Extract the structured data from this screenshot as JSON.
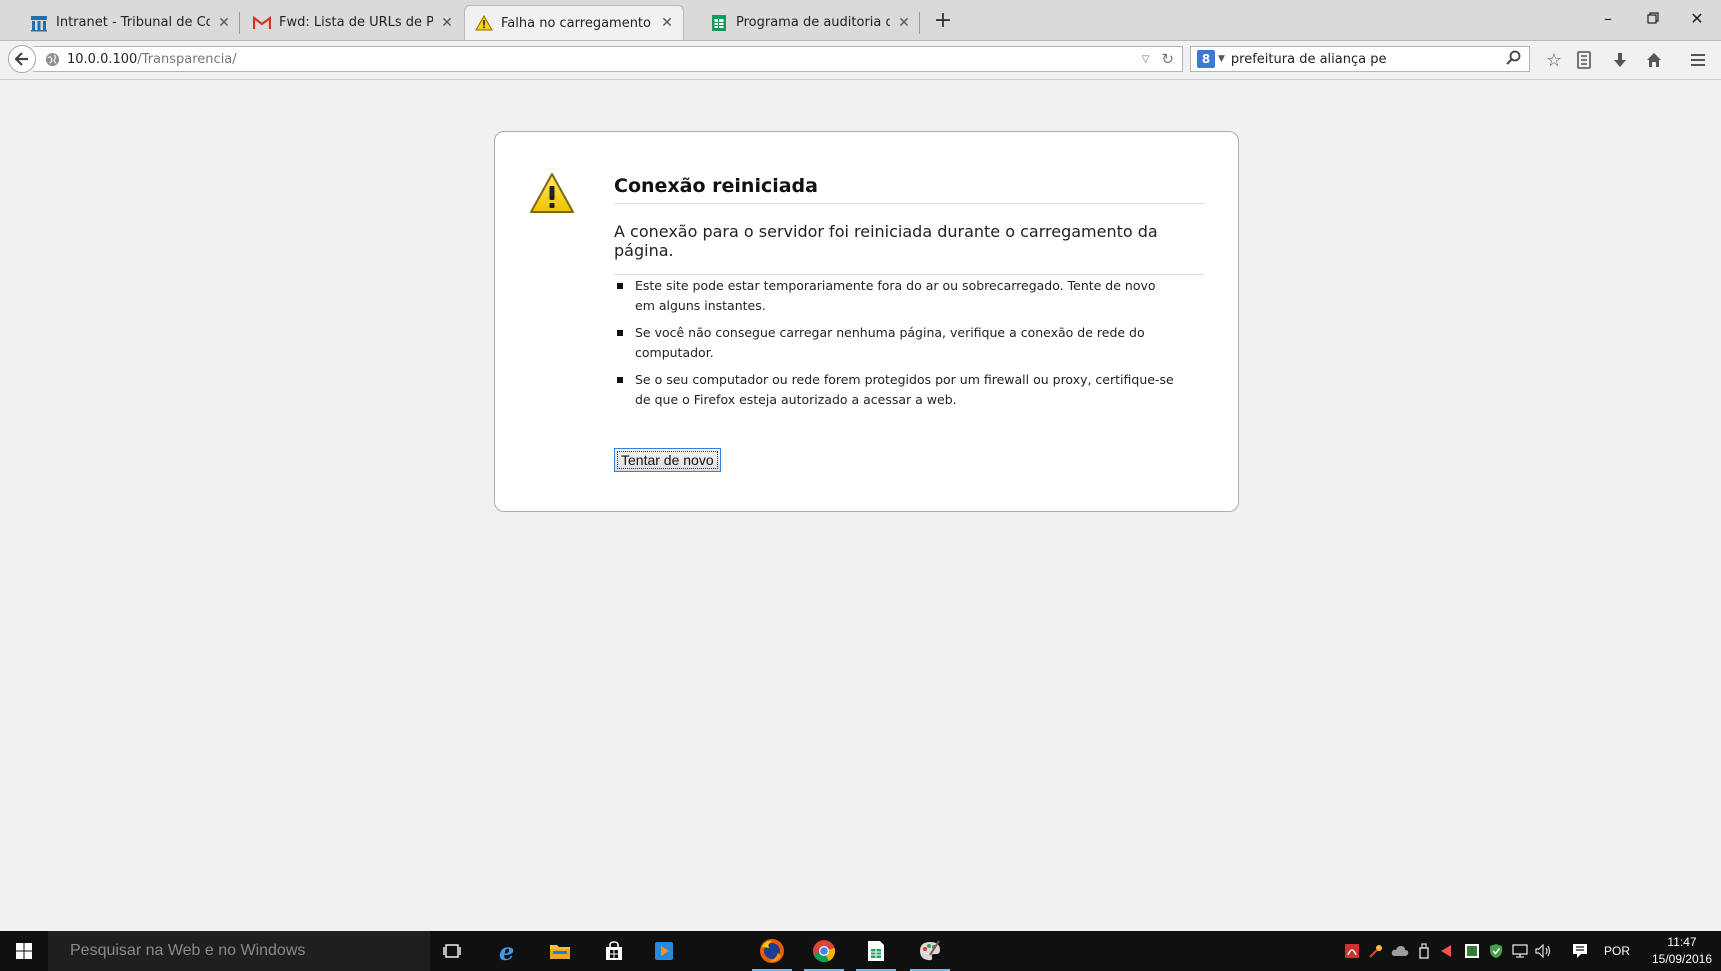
{
  "tabs": [
    {
      "title": "Intranet - Tribunal de Cont...",
      "icon": "intranet-icon"
    },
    {
      "title": "Fwd: Lista de URLs de Port...",
      "icon": "gmail-icon"
    },
    {
      "title": "Falha no carregamento da ...",
      "icon": "warning-icon"
    },
    {
      "title": "Programa de auditoria de ...",
      "icon": "sheets-icon"
    }
  ],
  "nav": {
    "url_host": "10.0.0.100",
    "url_path": "/Transparencia/",
    "search_value": "prefeitura de aliança pe",
    "search_engine_letter": "8"
  },
  "error": {
    "title": "Conexão reiniciada",
    "description": "A conexão para o servidor foi reiniciada durante o carregamento da página.",
    "items": [
      "Este site pode estar temporariamente fora do ar ou sobrecarregado. Tente de novo em alguns instantes.",
      "Se você não consegue carregar nenhuma página, verifique a conexão de rede do computador.",
      "Se o seu computador ou rede forem protegidos por um firewall ou proxy, certifique-se de que o Firefox esteja autorizado a acessar a web."
    ],
    "retry_label": "Tentar de novo"
  },
  "taskbar": {
    "search_placeholder": "Pesquisar na Web e no Windows",
    "language": "POR",
    "time": "11:47",
    "date": "15/09/2016"
  },
  "colors": {
    "accent": "#3a7fd6",
    "taskbar": "#101010",
    "warning_yellow": "#f5d21c"
  }
}
